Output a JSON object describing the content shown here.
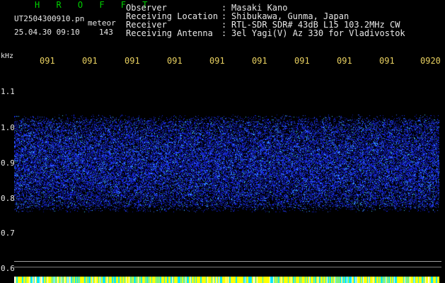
{
  "header": {
    "brand": "H R O F F T",
    "filename": "UT2504300910.pn",
    "detection_label": "meteor",
    "datetime": "25.04.30 09:10",
    "count": "143"
  },
  "station": {
    "rows": [
      {
        "label": "Observer",
        "value": "Masaki Kano"
      },
      {
        "label": "Receiving Location",
        "value": "Shibukawa, Gunma, Japan"
      },
      {
        "label": "Receiver",
        "value": "RTL-SDR SDR# 43dB L15 103.2MHz CW"
      },
      {
        "label": "Receiving Antenna",
        "value": "3el Yagi(V) Az 330 for Vladivostok"
      }
    ],
    "separator": ":"
  },
  "spectrogram": {
    "unit": "kHz",
    "y_ticks": [
      "1.1",
      "1.0",
      "0.9",
      "0.8",
      "0.7",
      "0.6"
    ],
    "x_ticks": [
      "091",
      "091",
      "091",
      "091",
      "091",
      "091",
      "091",
      "091",
      "091",
      "0920"
    ],
    "band_khz": [
      0.78,
      1.02
    ],
    "signal_color": "#1a2cff",
    "bottom_stripe_colors": [
      "#ffff00",
      "#00e8ff",
      "#ffffff"
    ]
  }
}
